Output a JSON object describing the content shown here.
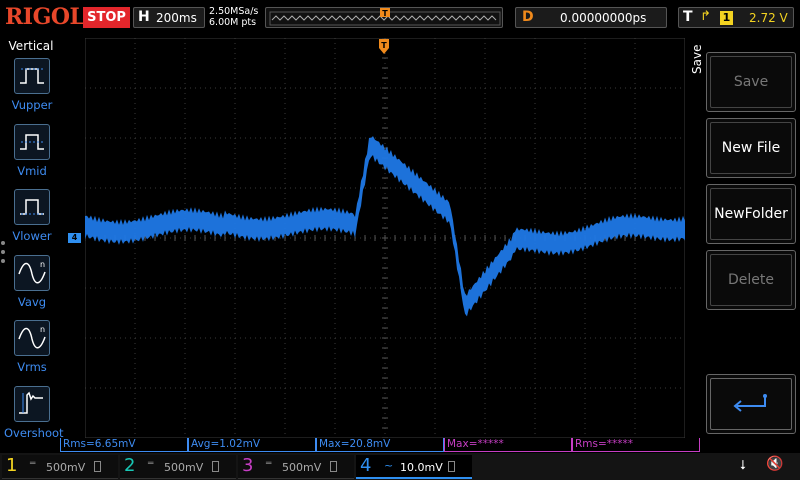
{
  "topbar": {
    "logo": "RIGOL",
    "run_state": "STOP",
    "horizontal": {
      "label": "H",
      "timebase": "200ms"
    },
    "sample_rate": "2.50MSa/s",
    "mem_depth": "6.00M pts",
    "trigger_pos_marker": "T",
    "delay": {
      "label": "D",
      "value": "0.00000000ps"
    },
    "trigger": {
      "label": "T",
      "edge": "rising-edge",
      "source": "1",
      "level": "2.72 V"
    }
  },
  "left_menu": {
    "title": "Vertical",
    "items": [
      {
        "label": "Vupper",
        "icon": "vupper-icon"
      },
      {
        "label": "Vmid",
        "icon": "vmid-icon"
      },
      {
        "label": "Vlower",
        "icon": "vlower-icon"
      },
      {
        "label": "Vavg",
        "icon": "vavg-icon"
      },
      {
        "label": "Vrms",
        "icon": "vrms-icon"
      },
      {
        "label": "Overshoot",
        "icon": "overshoot-icon"
      }
    ]
  },
  "right_menu": {
    "title": "Save",
    "buttons": [
      {
        "label": "Save",
        "enabled": false
      },
      {
        "label": "New File",
        "enabled": true
      },
      {
        "label": "NewFolder",
        "enabled": true
      },
      {
        "label": "Delete",
        "enabled": false
      },
      {
        "label": "",
        "icon": "enter-arrow-icon",
        "enabled": true
      }
    ]
  },
  "measurements": [
    {
      "text": "Rms=6.65mV",
      "active": true
    },
    {
      "text": "Avg=1.02mV",
      "active": true
    },
    {
      "text": "Max=20.8mV",
      "active": true
    },
    {
      "text": "Max=*****",
      "active": false
    },
    {
      "text": "Rms=*****",
      "active": false
    }
  ],
  "channels": [
    {
      "num": "1",
      "coupling": "DC",
      "scale": "500mV",
      "color": "#f3d321",
      "active": false
    },
    {
      "num": "2",
      "coupling": "DC",
      "scale": "500mV",
      "color": "#18c7b5",
      "active": false
    },
    {
      "num": "3",
      "coupling": "DC",
      "scale": "500mV",
      "color": "#c63ec4",
      "active": false
    },
    {
      "num": "4",
      "coupling": "AC",
      "scale": "10.0mV",
      "color": "#2f8ff0",
      "active": true
    }
  ],
  "ch4_marker": "4",
  "colors": {
    "trace": "#1f78e6",
    "stop": "#e3262b",
    "trigger": "#f08a1c",
    "measure": "#3e8cf2",
    "measure_empty": "#c63ec4"
  }
}
